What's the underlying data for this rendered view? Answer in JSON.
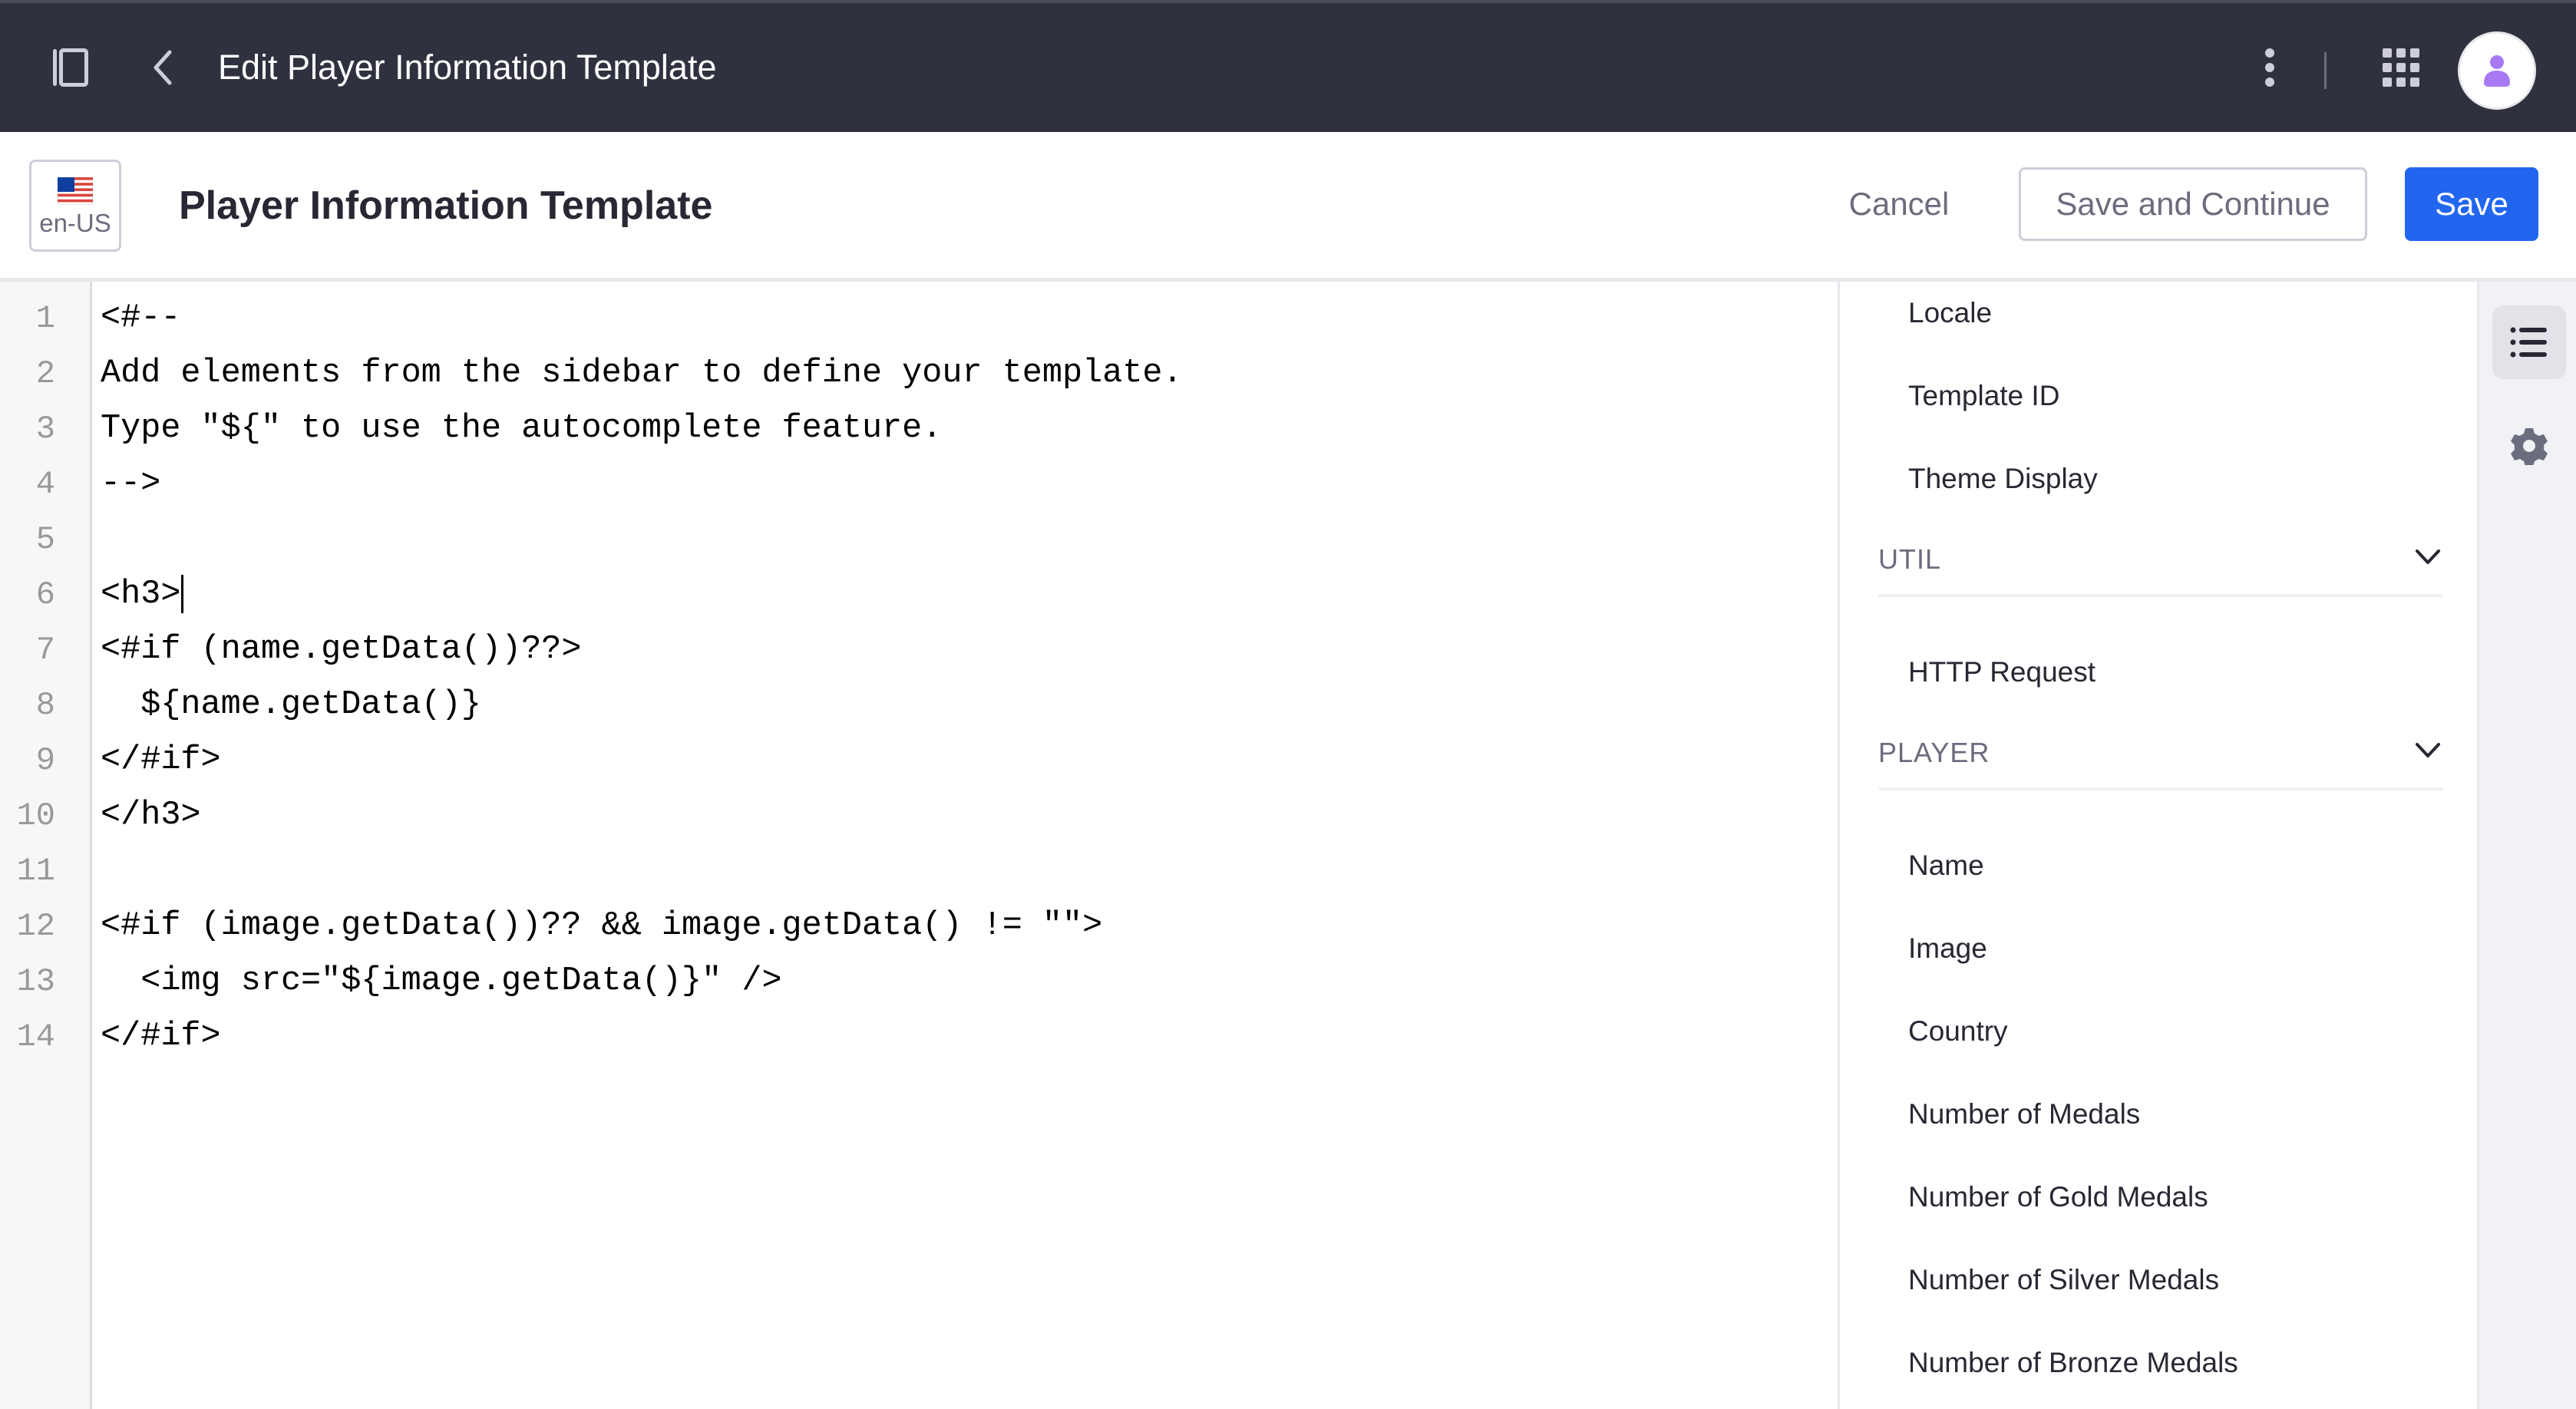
{
  "app_bar": {
    "title": "Edit Player Information Template",
    "icons": {
      "sidebar_toggle": "sidebar-toggle-icon",
      "back": "chevron-left-icon",
      "more": "kebab-vertical-icon",
      "apps": "apps-grid-icon",
      "avatar": "user-avatar-icon"
    },
    "colors": {
      "background": "#30313f",
      "avatar_icon": "#a779f3"
    }
  },
  "subheader": {
    "locale": {
      "label": "en-US",
      "flag": "us-flag-icon"
    },
    "title": "Player Information Template",
    "actions": {
      "cancel": "Cancel",
      "save_and_continue": "Save and Continue",
      "save": "Save"
    },
    "colors": {
      "primary": "#2266f0"
    }
  },
  "editor": {
    "cursor_line": 6,
    "lines": [
      {
        "num": "1",
        "text": "<#--"
      },
      {
        "num": "2",
        "text": "Add elements from the sidebar to define your template."
      },
      {
        "num": "3",
        "text": "Type \"${\" to use the autocomplete feature."
      },
      {
        "num": "4",
        "text": "-->"
      },
      {
        "num": "5",
        "text": ""
      },
      {
        "num": "6",
        "text": "<h3>"
      },
      {
        "num": "7",
        "text": "<#if (name.getData())??>"
      },
      {
        "num": "8",
        "text": "  ${name.getData()}"
      },
      {
        "num": "9",
        "text": "</#if>"
      },
      {
        "num": "10",
        "text": "</h3>"
      },
      {
        "num": "11",
        "text": ""
      },
      {
        "num": "12",
        "text": "<#if (image.getData())?? && image.getData() != \"\">"
      },
      {
        "num": "13",
        "text": "  <img src=\"${image.getData()}\" />"
      },
      {
        "num": "14",
        "text": "</#if>"
      }
    ]
  },
  "sidebar": {
    "general_items": [
      "Locale",
      "Template ID",
      "Theme Display"
    ],
    "sections": [
      {
        "label": "UTIL",
        "expanded": true,
        "items": [
          "HTTP Request"
        ]
      },
      {
        "label": "PLAYER",
        "expanded": true,
        "items": [
          "Name",
          "Image",
          "Country",
          "Number of Medals",
          "Number of Gold Medals",
          "Number of Silver Medals",
          "Number of Bronze Medals"
        ]
      }
    ]
  },
  "right_toolbar": {
    "buttons": [
      {
        "icon": "list-icon",
        "active": true
      },
      {
        "icon": "gear-icon",
        "active": false
      }
    ]
  }
}
